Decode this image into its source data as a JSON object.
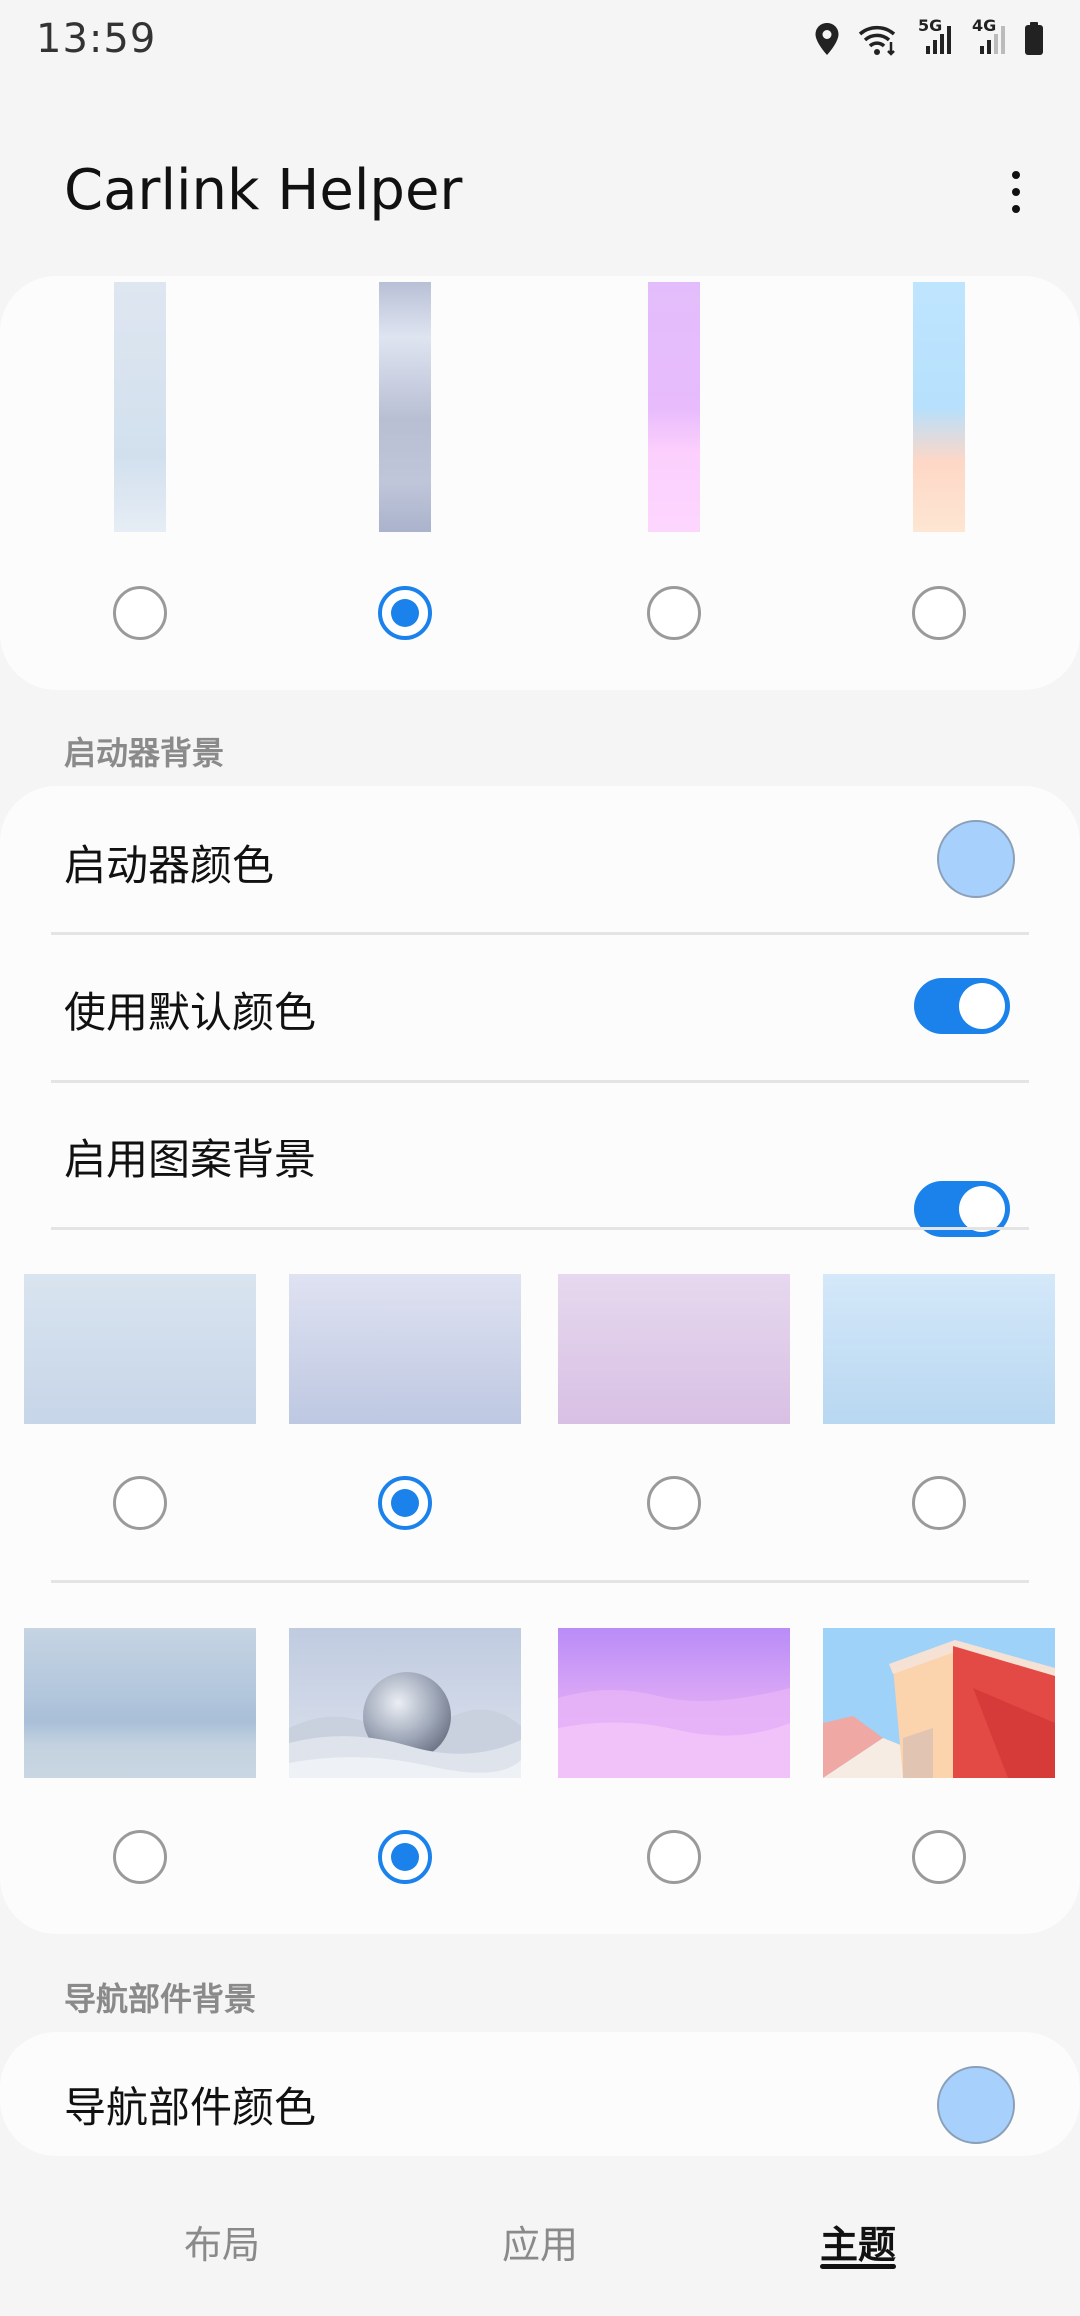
{
  "status": {
    "time": "13:59",
    "net1": "5G",
    "net2": "4G"
  },
  "header": {
    "title": "Carlink Helper"
  },
  "dock_styles": {
    "options": [
      {
        "name": "light-blue-gray",
        "selected": false
      },
      {
        "name": "gray-blue",
        "selected": true
      },
      {
        "name": "purple-pink",
        "selected": false
      },
      {
        "name": "sky-peach",
        "selected": false
      }
    ]
  },
  "launcher_bg": {
    "section_label": "启动器背景",
    "color_label": "启动器颜色",
    "color_value": "#a8d0fd",
    "default_color_label": "使用默认颜色",
    "default_color_on": true,
    "pattern_label": "启用图案背景",
    "pattern_on": true,
    "gradients": [
      {
        "name": "gradient-light-blue",
        "selected": false
      },
      {
        "name": "gradient-lavender",
        "selected": true
      },
      {
        "name": "gradient-pink-purple",
        "selected": false
      },
      {
        "name": "gradient-sky-blue",
        "selected": false
      }
    ],
    "images": [
      {
        "name": "blurred-blue",
        "selected": false
      },
      {
        "name": "glass-dome-landscape",
        "selected": true
      },
      {
        "name": "purple-clouds",
        "selected": false
      },
      {
        "name": "red-building",
        "selected": false
      }
    ]
  },
  "nav_widget_bg": {
    "section_label": "导航部件背景",
    "color_label": "导航部件颜色",
    "color_value": "#a8d0fd"
  },
  "bottom_nav": {
    "tabs": [
      {
        "label": "布局",
        "active": false
      },
      {
        "label": "应用",
        "active": false
      },
      {
        "label": "主题",
        "active": true
      }
    ]
  },
  "colors": {
    "accent": "#1a82ea",
    "background": "#f5f5f5",
    "card": "#fcfcfc"
  }
}
